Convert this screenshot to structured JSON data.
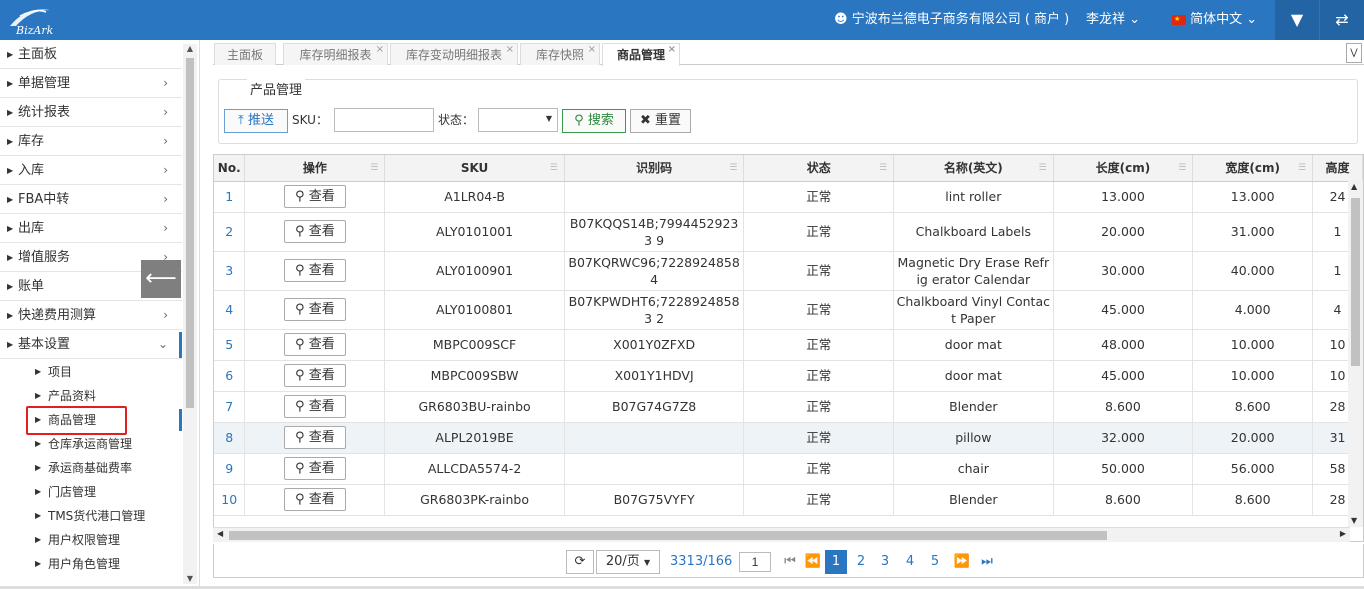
{
  "header": {
    "logo_text": "BizArk",
    "company": "宁波布兰德电子商务有限公司 ( 商户 )",
    "user": "李龙祥",
    "language": "简体中文"
  },
  "sidebar": {
    "items": [
      {
        "label": "主面板"
      },
      {
        "label": "单据管理"
      },
      {
        "label": "统计报表"
      },
      {
        "label": "库存"
      },
      {
        "label": "入库"
      },
      {
        "label": "FBA中转"
      },
      {
        "label": "出库"
      },
      {
        "label": "增值服务"
      },
      {
        "label": "账单"
      },
      {
        "label": "快递费用测算"
      },
      {
        "label": "基本设置"
      }
    ],
    "sub_items": [
      {
        "label": "项目"
      },
      {
        "label": "产品资料"
      },
      {
        "label": "商品管理"
      },
      {
        "label": "仓库承运商管理"
      },
      {
        "label": "承运商基础费率"
      },
      {
        "label": "门店管理"
      },
      {
        "label": "TMS货代港口管理"
      },
      {
        "label": "用户权限管理"
      },
      {
        "label": "用户角色管理"
      }
    ]
  },
  "tabs": [
    {
      "label": "主面板"
    },
    {
      "label": "库存明细报表"
    },
    {
      "label": "库存变动明细报表"
    },
    {
      "label": "库存快照"
    },
    {
      "label": "商品管理"
    }
  ],
  "panel": {
    "title": "产品管理",
    "push_label": "推送",
    "sku_label": "SKU：",
    "sku_value": "",
    "status_label": "状态：",
    "status_value": "",
    "search_label": "搜索",
    "reset_label": "重置"
  },
  "table": {
    "columns": [
      "No.",
      "操作",
      "SKU",
      "识别码",
      "状态",
      "名称(英文)",
      "长度(cm)",
      "宽度(cm)",
      "高度"
    ],
    "view_label": "查看",
    "rows": [
      {
        "no": "1",
        "sku": "A1LR04-B",
        "code": "",
        "status": "正常",
        "name": "lint roller",
        "length": "13.000",
        "width": "13.000",
        "height": "24"
      },
      {
        "no": "2",
        "sku": "ALY0101001",
        "code": "B07KQQS14B;79944529233 9",
        "status": "正常",
        "name": "Chalkboard Labels",
        "length": "20.000",
        "width": "31.000",
        "height": "1"
      },
      {
        "no": "3",
        "sku": "ALY0100901",
        "code": "B07KQRWC96;72289248584",
        "status": "正常",
        "name": "Magnetic Dry Erase Refrig erator Calendar",
        "length": "30.000",
        "width": "40.000",
        "height": "1"
      },
      {
        "no": "4",
        "sku": "ALY0100801",
        "code": "B07KPWDHT6;72289248583 2",
        "status": "正常",
        "name": "Chalkboard Vinyl Contact Paper",
        "length": "45.000",
        "width": "4.000",
        "height": "4"
      },
      {
        "no": "5",
        "sku": "MBPC009SCF",
        "code": "X001Y0ZFXD",
        "status": "正常",
        "name": "door mat",
        "length": "48.000",
        "width": "10.000",
        "height": "10"
      },
      {
        "no": "6",
        "sku": "MBPC009SBW",
        "code": "X001Y1HDVJ",
        "status": "正常",
        "name": "door mat",
        "length": "45.000",
        "width": "10.000",
        "height": "10"
      },
      {
        "no": "7",
        "sku": "GR6803BU-rainbo",
        "code": "B07G74G7Z8",
        "status": "正常",
        "name": "Blender",
        "length": "8.600",
        "width": "8.600",
        "height": "28"
      },
      {
        "no": "8",
        "sku": "ALPL2019BE",
        "code": "",
        "status": "正常",
        "name": "pillow",
        "length": "32.000",
        "width": "20.000",
        "height": "31"
      },
      {
        "no": "9",
        "sku": "ALLCDA5574-2",
        "code": "",
        "status": "正常",
        "name": "chair",
        "length": "50.000",
        "width": "56.000",
        "height": "58"
      },
      {
        "no": "10",
        "sku": "GR6803PK-rainbo",
        "code": "B07G75VYFY",
        "status": "正常",
        "name": "Blender",
        "length": "8.600",
        "width": "8.600",
        "height": "28"
      }
    ]
  },
  "pager": {
    "page_size": "20/页",
    "total": "3313/166",
    "page_input": "1",
    "pages": [
      "1",
      "2",
      "3",
      "4",
      "5"
    ]
  },
  "colors": {
    "brand": "#2a76c1",
    "highlight": "#e02020"
  }
}
